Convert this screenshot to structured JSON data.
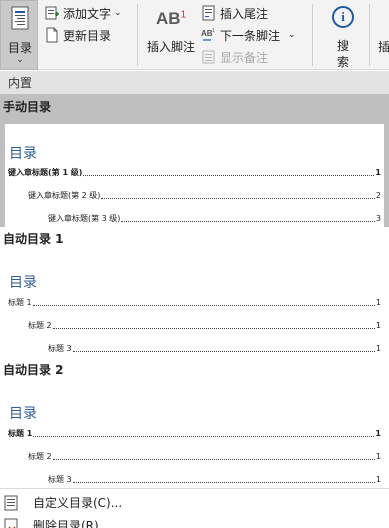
{
  "ribbon": {
    "toc_button_label": "目录",
    "add_text_label": "添加文字",
    "update_toc_label": "更新目录",
    "insert_footnote_label": "插入脚注",
    "ab_superscript": "1",
    "insert_endnote_label": "插入尾注",
    "next_footnote_label": "下一条脚注",
    "show_notes_label": "显示备注",
    "search_label": "搜索",
    "next_group_label_partial": "插"
  },
  "gallery": {
    "section_builtin": "内置",
    "groups": [
      {
        "title": "手动目录",
        "preview_title": "目录",
        "lines": [
          {
            "text": "键入章标题(第 1 级)",
            "page": "1"
          },
          {
            "text": "键入章标题(第 2 级)",
            "page": "2"
          },
          {
            "text": "键入章标题(第 3 级)",
            "page": "3"
          }
        ]
      },
      {
        "title": "自动目录 1",
        "preview_title": "目录",
        "lines": [
          {
            "text": "标题 1",
            "page": "1"
          },
          {
            "text": "标题 2",
            "page": "1"
          },
          {
            "text": "标题 3",
            "page": "1"
          }
        ]
      },
      {
        "title": "自动目录 2",
        "preview_title": "目录",
        "lines": [
          {
            "text": "标题 1",
            "page": "1"
          },
          {
            "text": "标题 2",
            "page": "1"
          },
          {
            "text": "标题 3",
            "page": "1"
          }
        ]
      }
    ]
  },
  "menu": {
    "custom_toc": "自定义目录(C)...",
    "remove_toc": "删除目录(R)"
  },
  "colors": {
    "heading_blue": "#2e5e9a",
    "selected_bg": "#bfbfbf",
    "ribbon_bg": "#f3f3f3",
    "section_bg": "#e3e3e3"
  }
}
